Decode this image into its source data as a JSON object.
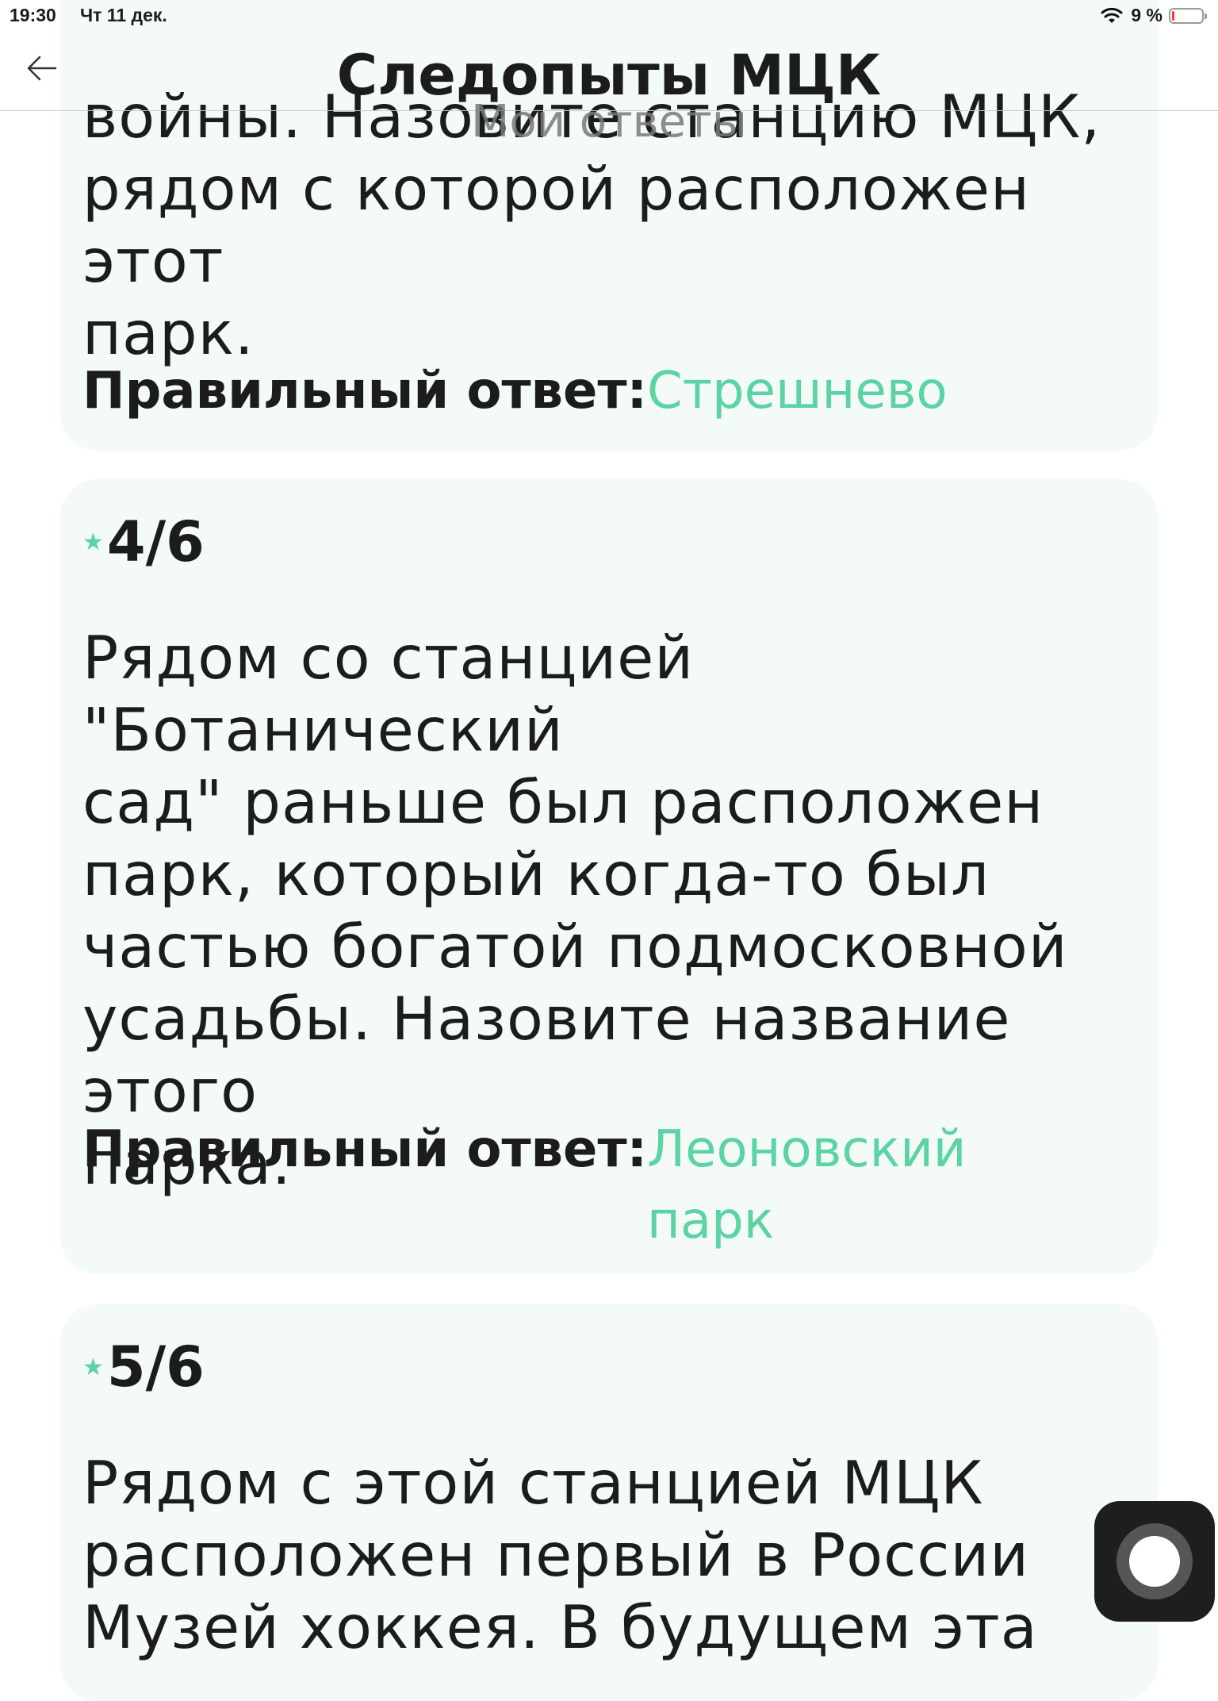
{
  "status_bar": {
    "time": "19:30",
    "date": "Чт 11 дек.",
    "battery_percent": "9 %",
    "battery_level": 0.09
  },
  "header": {
    "title": "Следопыты МЦК",
    "subtitle": "Мои ответы"
  },
  "questions": [
    {
      "text": "войны. Назовите станцию МЦК,\nрядом с которой расположен этот\nпарк.",
      "answer_label": "Правильный ответ:",
      "answer": "Стрешнево"
    },
    {
      "number": "4/6",
      "text": "Рядом со станцией \"Ботанический\nсад\" раньше был расположен\nпарк, который когда-то был\nчастью богатой подмосковной\nусадьбы. Назовите название этого\nпарка.",
      "answer_label": "Правильный ответ:",
      "answer": "Леоновский\nпарк"
    },
    {
      "number": "5/6",
      "text": "Рядом с этой станцией МЦК\nрасположен первый в России\nМузей хоккея. В будущем эта"
    }
  ],
  "colors": {
    "accent": "#5bd3a2",
    "card_background": "#f3faf8",
    "text": "#1c1c1e"
  }
}
